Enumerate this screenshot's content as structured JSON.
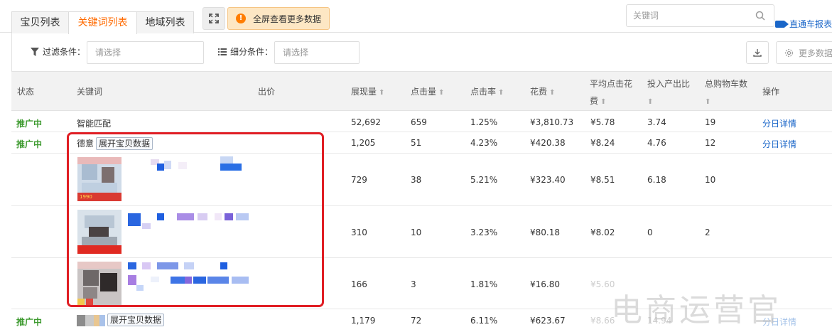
{
  "tabs": [
    {
      "label": "宝贝列表",
      "active": false
    },
    {
      "label": "关键词列表",
      "active": true
    },
    {
      "label": "地域列表",
      "active": false
    }
  ],
  "notice_button": {
    "label": "全屏查看更多数据"
  },
  "search": {
    "placeholder": "关键词"
  },
  "report_link": {
    "label": "直通车报表"
  },
  "filter": {
    "filter_label": "过滤条件：",
    "filter_placeholder": "请选择",
    "segment_label": "细分条件：",
    "segment_placeholder": "请选择",
    "more_label": "更多数据"
  },
  "columns": {
    "status": "状态",
    "keyword": "关键词",
    "bid": "出价",
    "impressions": "展现量",
    "clicks": "点击量",
    "ctr": "点击率",
    "cost": "花费",
    "cpc_line1": "平均点击花",
    "cpc_line2": "费",
    "roi": "投入产出比",
    "cart_line1": "总购物车数",
    "action": "操作"
  },
  "rows": [
    {
      "status": "推广中",
      "keyword": "智能匹配",
      "impressions": "52,692",
      "clicks": "659",
      "ctr": "1.25%",
      "cost": "¥3,810.73",
      "cpc": "¥5.78",
      "roi": "3.74",
      "cart": "19",
      "action": "分日详情"
    },
    {
      "status": "推广中",
      "keyword": "德意",
      "expand": "展开宝贝数据",
      "impressions": "1,205",
      "clicks": "51",
      "ctr": "4.23%",
      "cost": "¥420.38",
      "cpc": "¥8.24",
      "roi": "4.76",
      "cart": "12",
      "action": "分日详情"
    },
    {
      "impressions": "729",
      "clicks": "38",
      "ctr": "5.21%",
      "cost": "¥323.40",
      "cpc": "¥8.51",
      "roi": "6.18",
      "cart": "10"
    },
    {
      "impressions": "310",
      "clicks": "10",
      "ctr": "3.23%",
      "cost": "¥80.18",
      "cpc": "¥8.02",
      "roi": "0",
      "cart": "2"
    },
    {
      "impressions": "166",
      "clicks": "3",
      "ctr": "1.81%",
      "cost": "¥16.80",
      "cpc": "¥5.60"
    },
    {
      "status": "推广中",
      "expand": "展开宝贝数据",
      "impressions": "1,179",
      "clicks": "72",
      "ctr": "6.11%",
      "cost": "¥623.67",
      "cpc": "¥8.66",
      "roi": "14.94",
      "action": "分日详情"
    }
  ],
  "thumb_badge": "1990",
  "watermark": "电商运营官",
  "colors": {
    "accent": "#ff6a00",
    "status_green": "#3d9a2f",
    "link_blue": "#1a66c8",
    "highlight_red": "#e01e24"
  }
}
